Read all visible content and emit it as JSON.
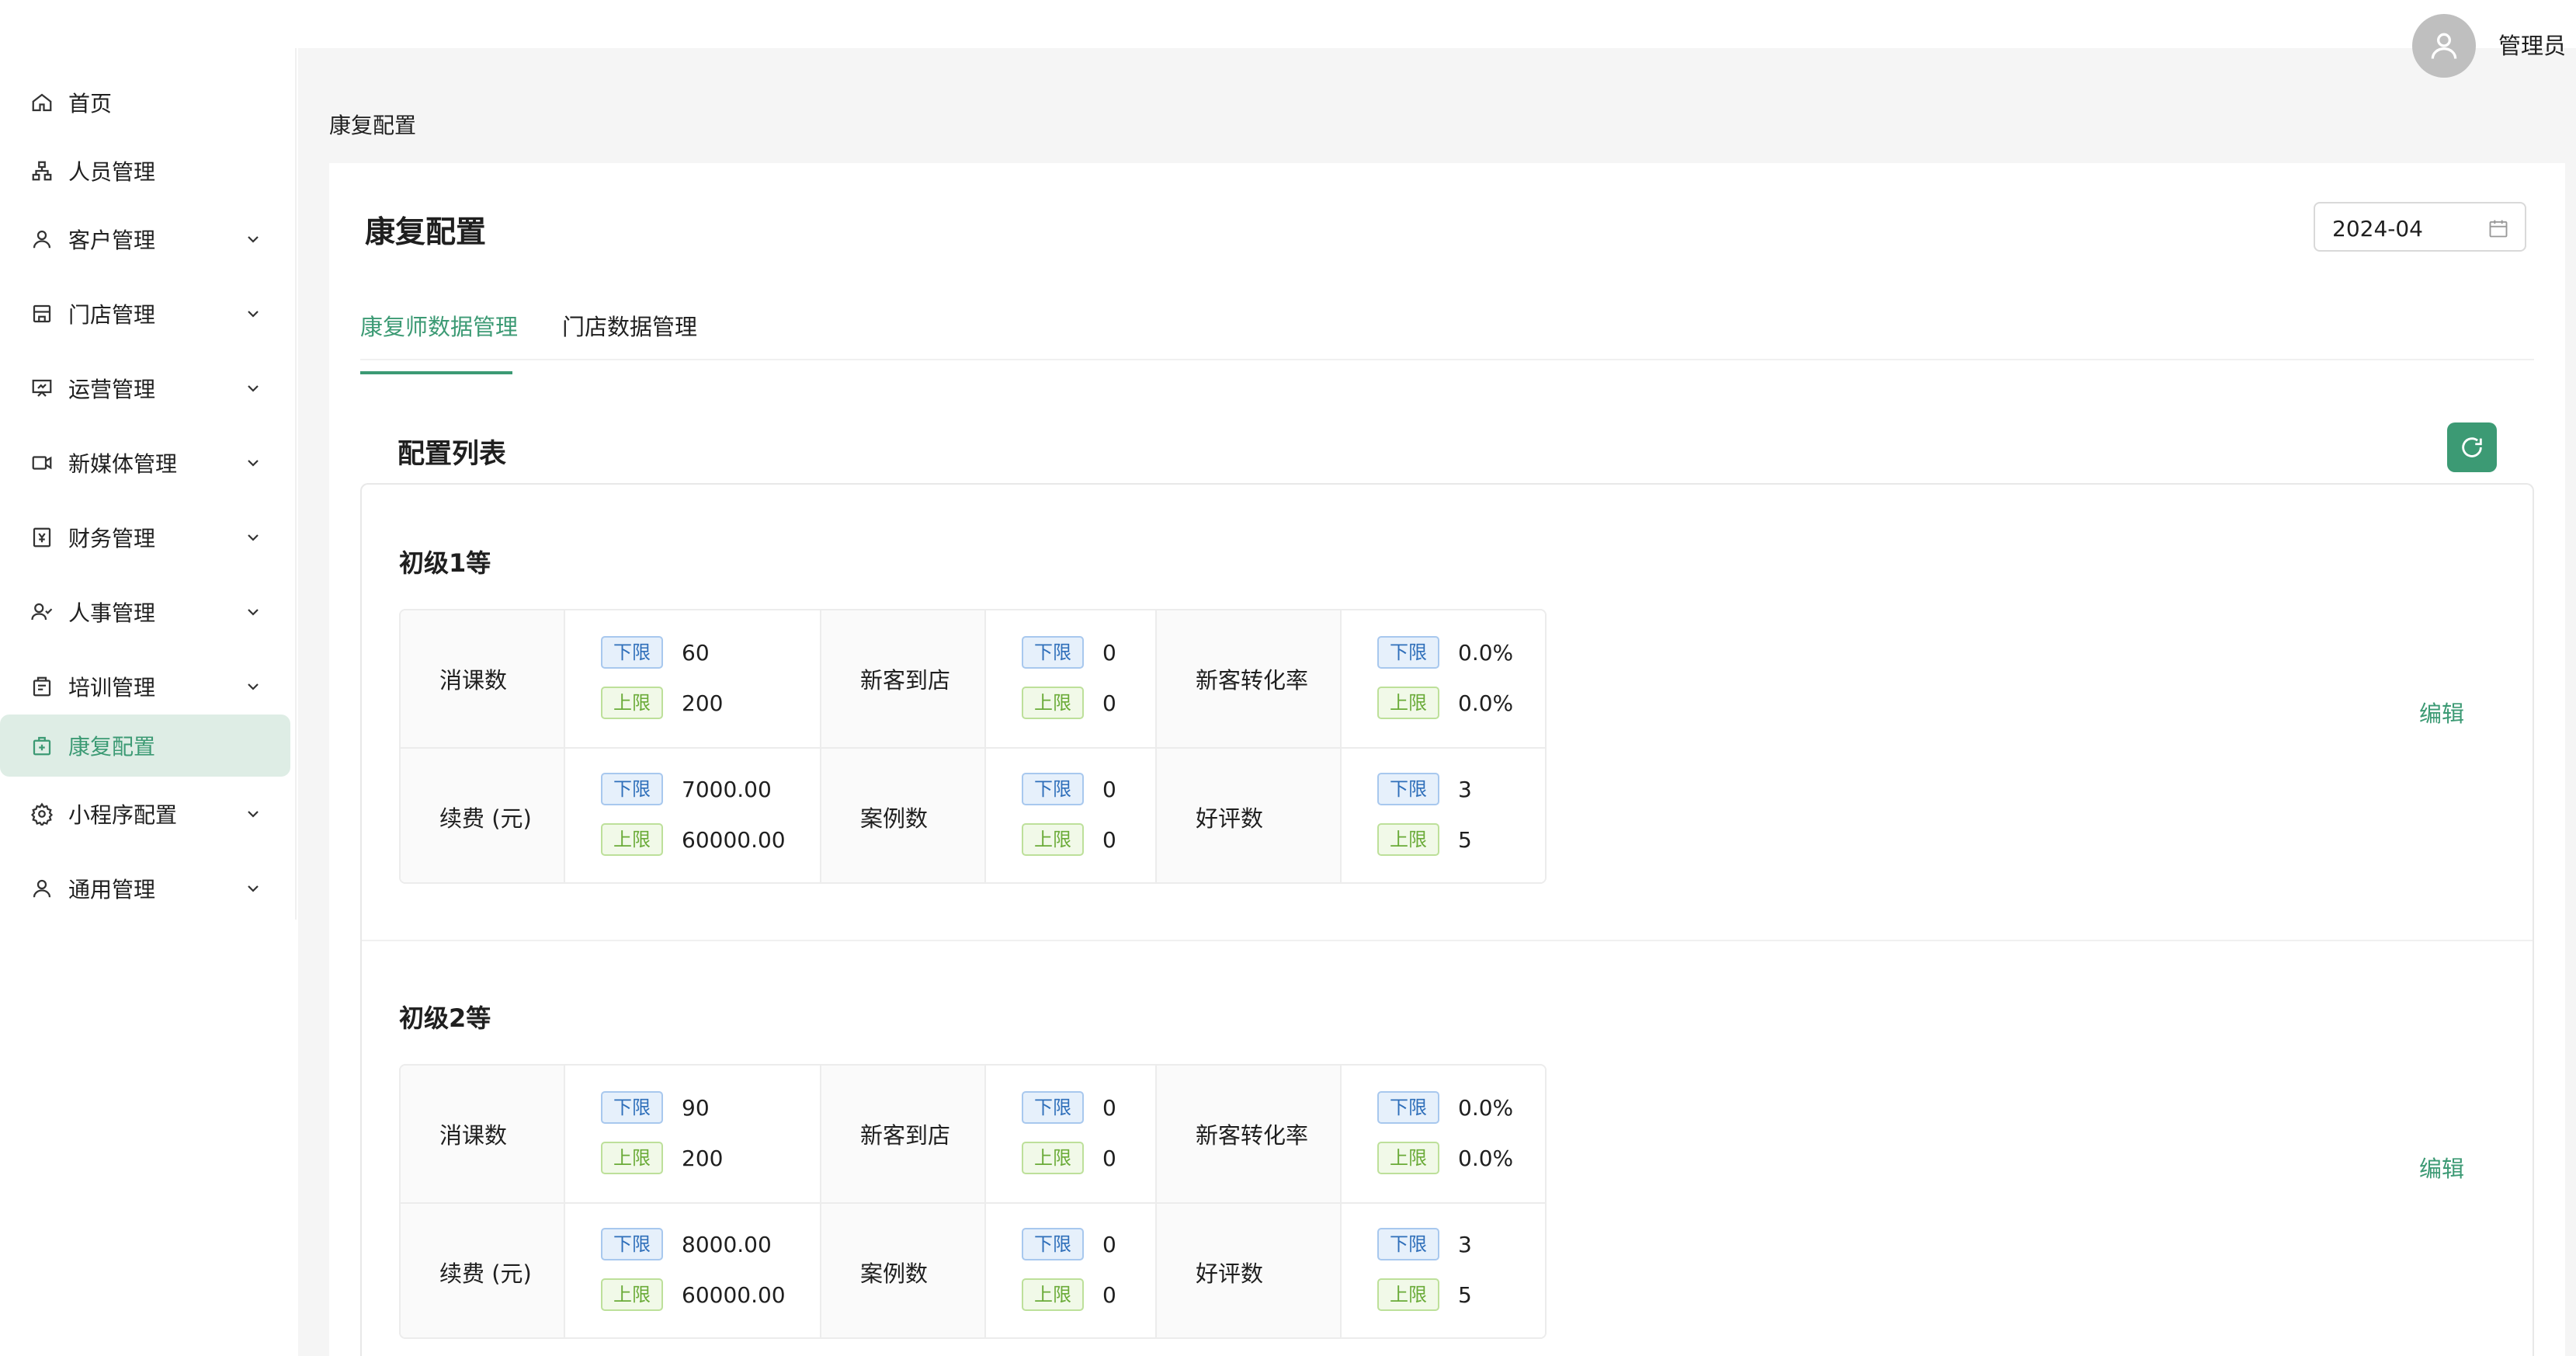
{
  "header": {
    "user_name": "管理员"
  },
  "sidebar": {
    "items": [
      {
        "label": "首页",
        "icon": "home-icon",
        "has_arrow": false
      },
      {
        "label": "人员管理",
        "icon": "org-icon",
        "has_arrow": false
      },
      {
        "label": "客户管理",
        "icon": "user-icon",
        "has_arrow": true
      },
      {
        "label": "门店管理",
        "icon": "store-icon",
        "has_arrow": true
      },
      {
        "label": "运营管理",
        "icon": "presentation-icon",
        "has_arrow": true
      },
      {
        "label": "新媒体管理",
        "icon": "video-icon",
        "has_arrow": true
      },
      {
        "label": "财务管理",
        "icon": "finance-icon",
        "has_arrow": true
      },
      {
        "label": "人事管理",
        "icon": "people-icon",
        "has_arrow": true
      },
      {
        "label": "培训管理",
        "icon": "training-icon",
        "has_arrow": true
      },
      {
        "label": "康复配置",
        "icon": "rehab-icon",
        "has_arrow": false,
        "active": true
      },
      {
        "label": "小程序配置",
        "icon": "gear-icon",
        "has_arrow": true
      },
      {
        "label": "通用管理",
        "icon": "user-icon",
        "has_arrow": true
      }
    ]
  },
  "breadcrumb": "康复配置",
  "page": {
    "title": "康复配置",
    "date_value": "2024-04",
    "tabs": [
      "康复师数据管理",
      "门店数据管理"
    ],
    "section_title": "配置列表",
    "edit_label": "编辑",
    "tag_low": "下限",
    "tag_high": "上限"
  },
  "groups": [
    {
      "name": "初级1等",
      "rows": [
        [
          {
            "label": "消课数",
            "low": "60",
            "high": "200"
          },
          {
            "label": "新客到店",
            "low": "0",
            "high": "0"
          },
          {
            "label": "新客转化率",
            "low": "0.0%",
            "high": "0.0%"
          }
        ],
        [
          {
            "label": "续费 (元)",
            "low": "7000.00",
            "high": "60000.00"
          },
          {
            "label": "案例数",
            "low": "0",
            "high": "0"
          },
          {
            "label": "好评数",
            "low": "3",
            "high": "5"
          }
        ]
      ]
    },
    {
      "name": "初级2等",
      "rows": [
        [
          {
            "label": "消课数",
            "low": "90",
            "high": "200"
          },
          {
            "label": "新客到店",
            "low": "0",
            "high": "0"
          },
          {
            "label": "新客转化率",
            "low": "0.0%",
            "high": "0.0%"
          }
        ],
        [
          {
            "label": "续费 (元)",
            "low": "8000.00",
            "high": "60000.00"
          },
          {
            "label": "案例数",
            "low": "0",
            "high": "0"
          },
          {
            "label": "好评数",
            "low": "3",
            "high": "5"
          }
        ]
      ]
    }
  ],
  "colors": {
    "accent": "#3c9a74",
    "active_bg": "#deede5",
    "tag_low": "#2f6fba",
    "tag_high": "#6aab38"
  }
}
